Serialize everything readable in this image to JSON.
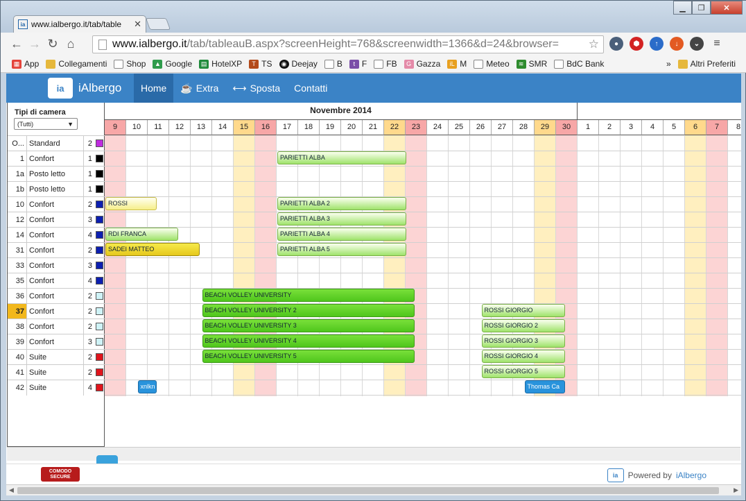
{
  "browser": {
    "tab_title": "www.ialbergo.it/tab/table",
    "url_host": "www.ialbergo.it",
    "url_path": "/tab/tableauB.aspx?screenHeight=768&screenwidth=1366&d=24&browser=",
    "bookmarks": [
      "App",
      "Collegamenti",
      "Shop",
      "Google",
      "HotelXP",
      "TS",
      "Deejay",
      "B",
      "F",
      "FB",
      "Gazza",
      "M",
      "Meteo",
      "SMR",
      "BdC Bank"
    ],
    "bookmarks_more": "»",
    "other_bookmarks": "Altri Preferiti"
  },
  "site": {
    "brand": "iAlbergo",
    "logo_text": "ia",
    "menu": [
      {
        "label": "Home",
        "icon": ""
      },
      {
        "label": "Extra",
        "icon": "☕"
      },
      {
        "label": "Sposta",
        "icon": "⟷"
      },
      {
        "label": "Contatti",
        "icon": ""
      }
    ]
  },
  "filter": {
    "label": "Tipi di camera",
    "selected": "(Tutti)"
  },
  "rooms": [
    {
      "num": "O...",
      "type": "Standard",
      "cap": "2",
      "color": "#c02be0"
    },
    {
      "num": "1",
      "type": "Confort",
      "cap": "1",
      "color": "#000000"
    },
    {
      "num": "1a",
      "type": "Posto letto",
      "cap": "1",
      "color": "#000000"
    },
    {
      "num": "1b",
      "type": "Posto letto",
      "cap": "1",
      "color": "#000000"
    },
    {
      "num": "10",
      "type": "Confort",
      "cap": "2",
      "color": "#0c1fb0"
    },
    {
      "num": "12",
      "type": "Confort",
      "cap": "3",
      "color": "#0c1fb0"
    },
    {
      "num": "14",
      "type": "Confort",
      "cap": "4",
      "color": "#0c1fb0"
    },
    {
      "num": "31",
      "type": "Confort",
      "cap": "2",
      "color": "#0c1fb0"
    },
    {
      "num": "33",
      "type": "Confort",
      "cap": "3",
      "color": "#0c1fb0"
    },
    {
      "num": "35",
      "type": "Confort",
      "cap": "4",
      "color": "#0c1fb0"
    },
    {
      "num": "36",
      "type": "Confort",
      "cap": "2",
      "color": "#cff3f7"
    },
    {
      "num": "37",
      "type": "Confort",
      "cap": "2",
      "color": "#cff3f7",
      "highlight": true
    },
    {
      "num": "38",
      "type": "Confort",
      "cap": "2",
      "color": "#cff3f7"
    },
    {
      "num": "39",
      "type": "Confort",
      "cap": "3",
      "color": "#cff3f7"
    },
    {
      "num": "40",
      "type": "Suite",
      "cap": "2",
      "color": "#e0141c"
    },
    {
      "num": "41",
      "type": "Suite",
      "cap": "2",
      "color": "#e0141c"
    },
    {
      "num": "42",
      "type": "Suite",
      "cap": "4",
      "color": "#e0141c"
    }
  ],
  "calendar": {
    "month_label": "Novembre 2014",
    "days": [
      {
        "d": "9",
        "k": "sun"
      },
      {
        "d": "10",
        "k": ""
      },
      {
        "d": "11",
        "k": ""
      },
      {
        "d": "12",
        "k": ""
      },
      {
        "d": "13",
        "k": ""
      },
      {
        "d": "14",
        "k": ""
      },
      {
        "d": "15",
        "k": "sat"
      },
      {
        "d": "16",
        "k": "sun"
      },
      {
        "d": "17",
        "k": ""
      },
      {
        "d": "18",
        "k": ""
      },
      {
        "d": "19",
        "k": ""
      },
      {
        "d": "20",
        "k": ""
      },
      {
        "d": "21",
        "k": ""
      },
      {
        "d": "22",
        "k": "sat"
      },
      {
        "d": "23",
        "k": "sun"
      },
      {
        "d": "24",
        "k": ""
      },
      {
        "d": "25",
        "k": ""
      },
      {
        "d": "26",
        "k": ""
      },
      {
        "d": "27",
        "k": ""
      },
      {
        "d": "28",
        "k": ""
      },
      {
        "d": "29",
        "k": "sat"
      },
      {
        "d": "30",
        "k": "sun"
      },
      {
        "d": "1",
        "k": ""
      },
      {
        "d": "2",
        "k": ""
      },
      {
        "d": "3",
        "k": ""
      },
      {
        "d": "4",
        "k": ""
      },
      {
        "d": "5",
        "k": ""
      },
      {
        "d": "6",
        "k": "sat"
      },
      {
        "d": "7",
        "k": "sun"
      },
      {
        "d": "8",
        "k": ""
      }
    ],
    "month_days": 22
  },
  "bookings": [
    {
      "name": "PARIETTI ALBA",
      "row": 1,
      "start": 8,
      "span": 6,
      "style": "lgreen"
    },
    {
      "name": "ROSSI",
      "row": 4,
      "start": 0,
      "span": 2.4,
      "style": "lyellow"
    },
    {
      "name": "PARIETTI ALBA 2",
      "row": 4,
      "start": 8,
      "span": 6,
      "style": "lgreen"
    },
    {
      "name": "PARIETTI ALBA 3",
      "row": 5,
      "start": 8,
      "span": 6,
      "style": "lgreen"
    },
    {
      "name": "RDI FRANCA",
      "row": 6,
      "start": 0,
      "span": 3.4,
      "style": "lgreen"
    },
    {
      "name": "PARIETTI ALBA 4",
      "row": 6,
      "start": 8,
      "span": 6,
      "style": "lgreen"
    },
    {
      "name": "SADEI MATTEO",
      "row": 7,
      "start": 0,
      "span": 4.4,
      "style": "gold"
    },
    {
      "name": "PARIETTI ALBA 5",
      "row": 7,
      "start": 8,
      "span": 6,
      "style": "lgreen"
    },
    {
      "name": "BEACH VOLLEY UNIVERSITY",
      "row": 10,
      "start": 4.5,
      "span": 9.9,
      "style": "dgreen"
    },
    {
      "name": "BEACH VOLLEY UNIVERSITY 2",
      "row": 11,
      "start": 4.5,
      "span": 9.9,
      "style": "dgreen"
    },
    {
      "name": "ROSSI GIORGIO",
      "row": 11,
      "start": 17.5,
      "span": 3.9,
      "style": "lgreen"
    },
    {
      "name": "BEACH VOLLEY UNIVERSITY 3",
      "row": 12,
      "start": 4.5,
      "span": 9.9,
      "style": "dgreen"
    },
    {
      "name": "ROSSI GIORGIO 2",
      "row": 12,
      "start": 17.5,
      "span": 3.9,
      "style": "lgreen"
    },
    {
      "name": "BEACH VOLLEY UNIVERSITY 4",
      "row": 13,
      "start": 4.5,
      "span": 9.9,
      "style": "dgreen"
    },
    {
      "name": "ROSSI GIORGIO 3",
      "row": 13,
      "start": 17.5,
      "span": 3.9,
      "style": "lgreen"
    },
    {
      "name": "BEACH VOLLEY UNIVERSITY 5",
      "row": 14,
      "start": 4.5,
      "span": 9.9,
      "style": "dgreen"
    },
    {
      "name": "ROSSI GIORGIO 4",
      "row": 14,
      "start": 17.5,
      "span": 3.9,
      "style": "lgreen"
    },
    {
      "name": "ROSSI GIORGIO 5",
      "row": 15,
      "start": 17.5,
      "span": 3.9,
      "style": "lgreen"
    },
    {
      "name": "xnlkn",
      "row": 16,
      "start": 1.5,
      "span": 0.9,
      "style": "blue"
    },
    {
      "name": "Thomas Ca",
      "row": 16,
      "start": 19.5,
      "span": 1.9,
      "style": "blue"
    }
  ],
  "footer": {
    "comodo": "COMODO SECURE",
    "powered_prefix": "Powered by",
    "powered_brand": "iAlbergo"
  }
}
